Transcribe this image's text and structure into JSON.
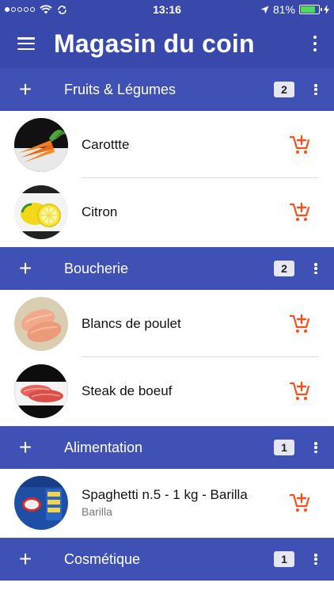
{
  "status": {
    "time": "13:16",
    "battery": "81%",
    "battery_level": 0.81,
    "signal_bars_filled": 1,
    "signal_bars_total": 5
  },
  "appbar": {
    "title": "Magasin du coin"
  },
  "categories": [
    {
      "name": "Fruits & Légumes",
      "count": "2",
      "items": [
        {
          "name": "Carottte",
          "sub": "",
          "thumb": "carrot"
        },
        {
          "name": "Citron",
          "sub": "",
          "thumb": "lemon"
        }
      ]
    },
    {
      "name": "Boucherie",
      "count": "2",
      "items": [
        {
          "name": "Blancs de poulet",
          "sub": "",
          "thumb": "chicken"
        },
        {
          "name": "Steak de boeuf",
          "sub": "",
          "thumb": "steak"
        }
      ]
    },
    {
      "name": "Alimentation",
      "count": "1",
      "items": [
        {
          "name": "Spaghetti n.5 - 1 kg - Barilla",
          "sub": "Barilla",
          "thumb": "pasta"
        }
      ]
    },
    {
      "name": "Cosmétique",
      "count": "1",
      "items": []
    }
  ],
  "icons": {
    "menu": "hamburger-icon",
    "overflow": "more-vertical-icon",
    "add": "plus-icon",
    "cart": "add-shopping-cart-icon"
  },
  "colors": {
    "primary_dark": "#3949ab",
    "primary": "#3f51b5",
    "accent": "#f4511e"
  }
}
